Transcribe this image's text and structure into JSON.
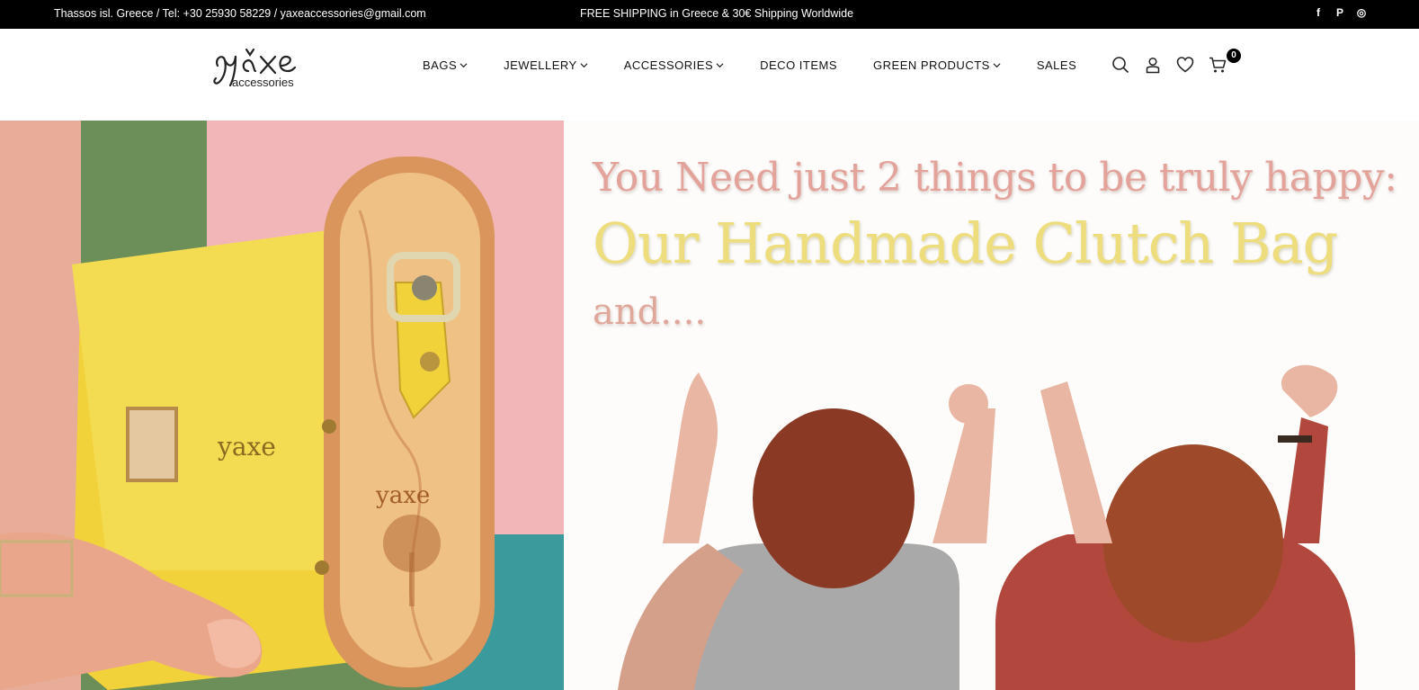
{
  "topbar": {
    "contact": "Thassos isl. Greece / Tel: +30 25930 58229 / yaxeaccessories@gmail.com",
    "shipping": "FREE SHIPPING in Greece & 30€ Shipping Worldwide",
    "socials": [
      {
        "icon": "facebook-icon",
        "glyph": "f"
      },
      {
        "icon": "pinterest-icon",
        "glyph": "P"
      },
      {
        "icon": "instagram-icon",
        "glyph": "◎"
      }
    ]
  },
  "header": {
    "logo_text": "yaxe accessories",
    "nav": [
      {
        "label": "BAGS",
        "dropdown": true
      },
      {
        "label": "JEWELLERY",
        "dropdown": true
      },
      {
        "label": "ACCESSORIES",
        "dropdown": true
      },
      {
        "label": "DECO ITEMS",
        "dropdown": false
      },
      {
        "label": "GREEN PRODUCTS",
        "dropdown": true
      },
      {
        "label": "SALES",
        "dropdown": false
      }
    ],
    "icons": [
      "search-icon",
      "account-icon",
      "wishlist-icon",
      "cart-icon"
    ],
    "cart_count": "0"
  },
  "hero": {
    "line1": "You Need just 2 things to be truly happy:",
    "line2": "Our Handmade Clutch Bag",
    "line3": "and....",
    "colors": {
      "line1": "#e3a39a",
      "line2": "#eedd7c",
      "line3": "#e0a89a"
    }
  }
}
